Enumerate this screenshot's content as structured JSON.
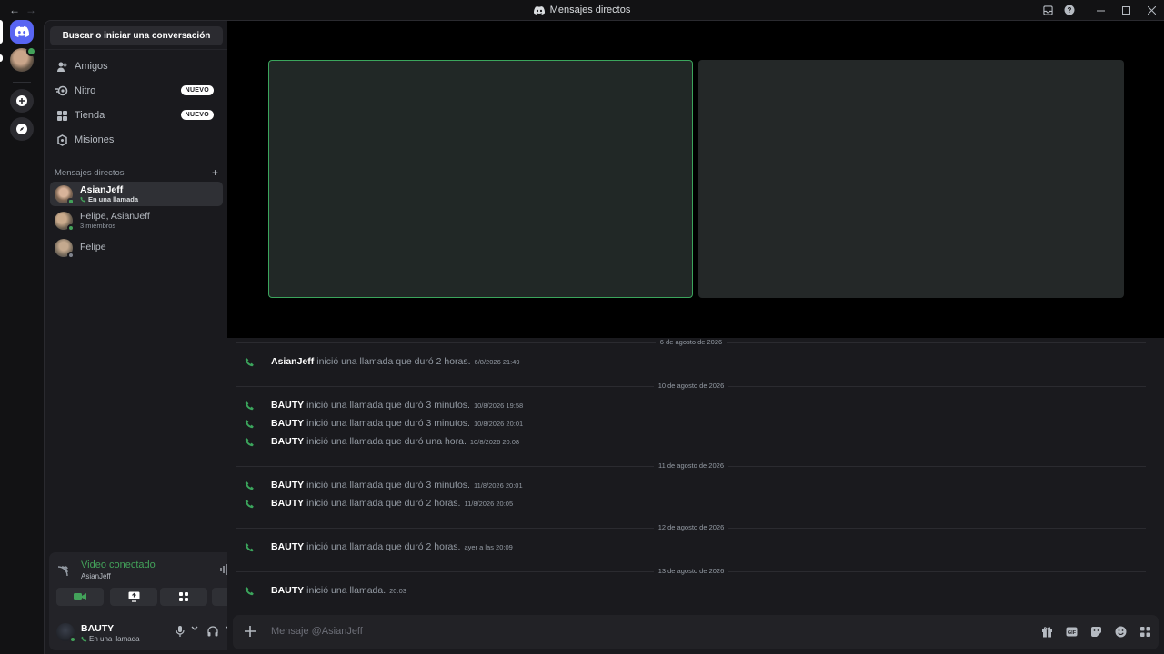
{
  "window": {
    "title": "Mensajes directos",
    "back_glyph": "←",
    "forward_glyph": "→"
  },
  "colors": {
    "accent": "#5865f2",
    "online": "#43a25a",
    "call_green": "#3ba55c",
    "badge_bg": "#ffffff"
  },
  "sidebar": {
    "search_label": "Buscar o iniciar una conversación",
    "nav": [
      {
        "label": "Amigos",
        "icon": "friends-icon",
        "badge": ""
      },
      {
        "label": "Nitro",
        "icon": "nitro-icon",
        "badge": "NUEVO"
      },
      {
        "label": "Tienda",
        "icon": "shop-icon",
        "badge": "NUEVO"
      },
      {
        "label": "Misiones",
        "icon": "quests-icon",
        "badge": ""
      }
    ],
    "dm_header": "Mensajes directos",
    "dms": [
      {
        "name": "AsianJeff",
        "sub": "En una llamada",
        "active": true
      },
      {
        "name": "Felipe, AsianJeff",
        "sub": "3 miembros",
        "active": false
      },
      {
        "name": "Felipe",
        "sub": "",
        "active": false
      }
    ]
  },
  "voice": {
    "status": "Video conectado",
    "channel": "AsianJeff",
    "user": {
      "name": "BAUTY",
      "status": "En una llamada"
    }
  },
  "chat": {
    "groups": [
      {
        "date": "6 de agosto de 2026",
        "messages": [
          {
            "who": "AsianJeff",
            "text": "inició una llamada que duró 2 horas.",
            "ts": "6/8/2026 21:49"
          }
        ]
      },
      {
        "date": "10 de agosto de 2026",
        "messages": [
          {
            "who": "BAUTY",
            "text": "inició una llamada que duró 3 minutos.",
            "ts": "10/8/2026 19:58"
          },
          {
            "who": "BAUTY",
            "text": "inició una llamada que duró 3 minutos.",
            "ts": "10/8/2026 20:01"
          },
          {
            "who": "BAUTY",
            "text": "inició una llamada que duró una hora.",
            "ts": "10/8/2026 20:08"
          }
        ]
      },
      {
        "date": "11 de agosto de 2026",
        "messages": [
          {
            "who": "BAUTY",
            "text": "inició una llamada que duró 3 minutos.",
            "ts": "11/8/2026 20:01"
          },
          {
            "who": "BAUTY",
            "text": "inició una llamada que duró 2 horas.",
            "ts": "11/8/2026 20:05"
          }
        ]
      },
      {
        "date": "12 de agosto de 2026",
        "messages": [
          {
            "who": "BAUTY",
            "text": "inició una llamada que duró 2 horas.",
            "ts": "ayer a las 20:09"
          }
        ]
      },
      {
        "date": "13 de agosto de 2026",
        "messages": [
          {
            "who": "BAUTY",
            "text": "inició una llamada.",
            "ts": "20:03"
          }
        ]
      }
    ]
  },
  "composer": {
    "placeholder": "Mensaje @AsianJeff"
  }
}
